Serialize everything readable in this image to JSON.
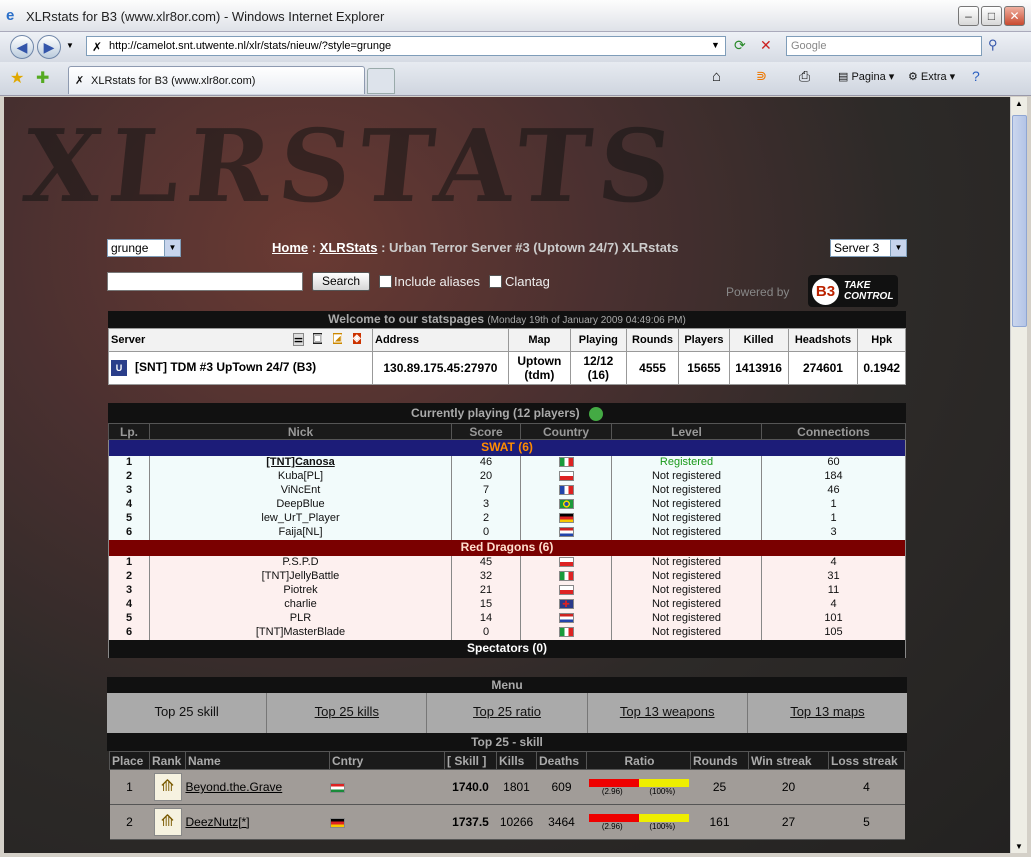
{
  "browser": {
    "title": "XLRstats for B3 (www.xlr8or.com) - Windows Internet Explorer",
    "url": "http://camelot.snt.utwente.nl/xlr/stats/nieuw/?style=grunge",
    "search_placeholder": "Google",
    "tab_label": "XLRstats for B3 (www.xlr8or.com)",
    "tools": {
      "page": "Pagina",
      "extra": "Extra"
    }
  },
  "page": {
    "logo": "XLRSTATS",
    "style_select": "grunge",
    "server_select": "Server 3",
    "crumb": {
      "home": "Home",
      "sep": " : ",
      "xlr": "XLRStats",
      "rest": " : Urban Terror Server #3 (Uptown 24/7) XLRstats"
    },
    "search_btn": "Search",
    "include_aliases": "Include aliases",
    "clantag": "Clantag",
    "powered": "Powered by",
    "b3_top": "TAKE",
    "b3_bottom": "CONTROL",
    "b3_mark": "B3",
    "welcome": "Welcome to our statspages",
    "welcome_date": "(Monday 19th of January 2009 04:49:06 PM)"
  },
  "server": {
    "headers": [
      "Server",
      "Address",
      "Map",
      "Playing",
      "Rounds",
      "Players",
      "Killed",
      "Headshots",
      "Hpk"
    ],
    "row": [
      "[SNT] TDM #3 UpTown 24/7 (B3)",
      "130.89.175.45:27970",
      "Uptown (tdm)",
      "12/12 (16)",
      "4555",
      "15655",
      "1413916",
      "274601",
      "0.1942"
    ]
  },
  "playing": {
    "caption": "Currently playing (12 players)",
    "headers": [
      "Lp.",
      "Nick",
      "Score",
      "Country",
      "Level",
      "Connections"
    ],
    "swat_label": "SWAT (6)",
    "red_label": "Red Dragons (6)",
    "spec_label": "Spectators (0)",
    "swat": [
      {
        "lp": "1",
        "nick": "[TNT]Canosa",
        "score": "46",
        "flag": "it",
        "level": "Registered",
        "conn": "60"
      },
      {
        "lp": "2",
        "nick": "Kuba[PL]",
        "score": "20",
        "flag": "pl",
        "level": "Not registered",
        "conn": "184"
      },
      {
        "lp": "3",
        "nick": "ViNcEnt",
        "score": "7",
        "flag": "fr",
        "level": "Not registered",
        "conn": "46"
      },
      {
        "lp": "4",
        "nick": "DeepBlue",
        "score": "3",
        "flag": "br",
        "level": "Not registered",
        "conn": "1"
      },
      {
        "lp": "5",
        "nick": "lew_UrT_Player",
        "score": "2",
        "flag": "de",
        "level": "Not registered",
        "conn": "1"
      },
      {
        "lp": "6",
        "nick": "Faija[NL]",
        "score": "0",
        "flag": "nl",
        "level": "Not registered",
        "conn": "3"
      }
    ],
    "red": [
      {
        "lp": "1",
        "nick": "P.S.P.D",
        "score": "45",
        "flag": "pl",
        "level": "Not registered",
        "conn": "4"
      },
      {
        "lp": "2",
        "nick": "[TNT]JellyBattle",
        "score": "32",
        "flag": "it",
        "level": "Not registered",
        "conn": "31"
      },
      {
        "lp": "3",
        "nick": "Piotrek",
        "score": "21",
        "flag": "pl",
        "level": "Not registered",
        "conn": "11"
      },
      {
        "lp": "4",
        "nick": "charlie",
        "score": "15",
        "flag": "gb",
        "level": "Not registered",
        "conn": "4"
      },
      {
        "lp": "5",
        "nick": "PLR",
        "score": "14",
        "flag": "nl",
        "level": "Not registered",
        "conn": "101"
      },
      {
        "lp": "6",
        "nick": "[TNT]MasterBlade",
        "score": "0",
        "flag": "it",
        "level": "Not registered",
        "conn": "105"
      }
    ]
  },
  "menu": {
    "title": "Menu",
    "items": [
      "Top 25 skill",
      "Top 25 kills",
      "Top 25 ratio",
      "Top 13 weapons",
      "Top 13 maps"
    ]
  },
  "top25": {
    "title": "Top 25 - skill",
    "headers": [
      "Place",
      "Rank",
      "Name",
      "Cntry",
      "[ Skill ]",
      "Kills",
      "Deaths",
      "Ratio",
      "Rounds",
      "Win streak",
      "Loss streak"
    ],
    "rows": [
      {
        "place": "1",
        "name": "Beyond.the.Grave",
        "flag": "hu",
        "skill": "1740.0",
        "kills": "1801",
        "deaths": "609",
        "ratio_a": "(2.96)",
        "ratio_b": "(100%)",
        "red": 0.5,
        "rounds": "25",
        "win": "20",
        "loss": "4"
      },
      {
        "place": "2",
        "name": "DeezNutz[*]",
        "flag": "de",
        "skill": "1737.5",
        "kills": "10266",
        "deaths": "3464",
        "ratio_a": "(2.96)",
        "ratio_b": "(100%)",
        "red": 0.5,
        "rounds": "161",
        "win": "27",
        "loss": "5"
      }
    ]
  },
  "colors": {
    "swat": "#1c1c78",
    "red": "#7a0000",
    "registered": "#1a9a1a"
  }
}
